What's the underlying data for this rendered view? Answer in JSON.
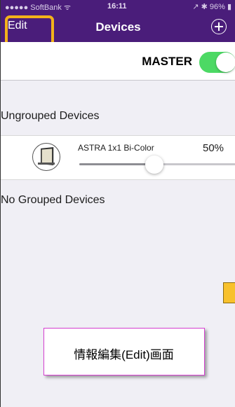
{
  "status_bar": {
    "carrier": "●●●●● SoftBank ᯤ",
    "time": "16:11",
    "right": "↗ ✱ 96% ▮"
  },
  "nav": {
    "edit_label": "Edit",
    "title": "Devices",
    "add_icon": "plus-circle-icon"
  },
  "master": {
    "label": "MASTER",
    "on": true
  },
  "ungrouped": {
    "header": "Ungrouped Devices",
    "devices": [
      {
        "name": "ASTRA 1x1 Bi-Color",
        "percent": "50%",
        "level": 0.48
      }
    ]
  },
  "grouped": {
    "header": "No Grouped Devices"
  },
  "annotation": {
    "text": "情報編集(Edit)画面"
  },
  "colors": {
    "nav_bg": "#4a1d7a",
    "highlight": "#f3b21b",
    "toggle_on": "#4cd964",
    "annotation_border": "#d63fd1"
  }
}
